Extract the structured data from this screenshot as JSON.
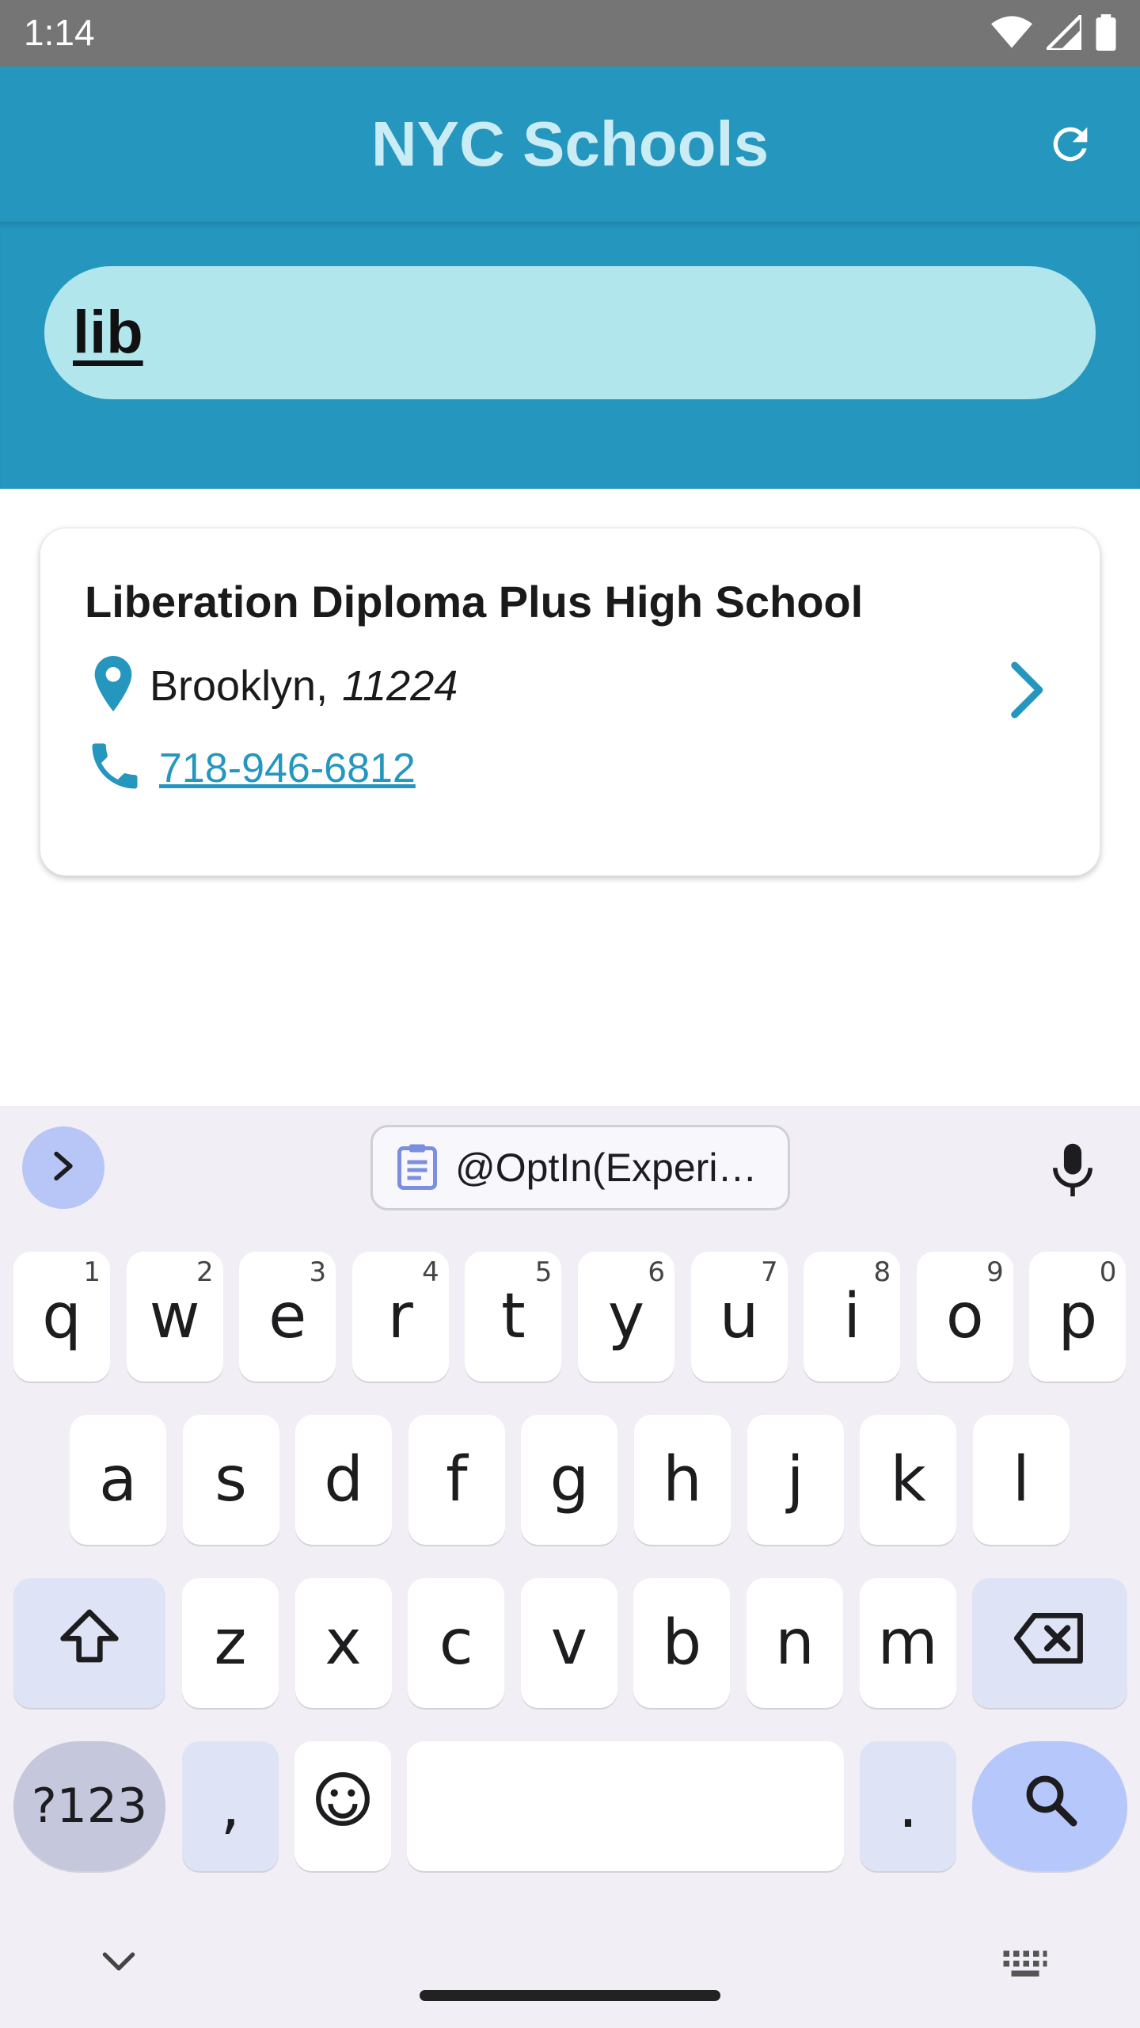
{
  "status_bar": {
    "time": "1:14"
  },
  "app_bar": {
    "title": "NYC Schools"
  },
  "search": {
    "query": "lib"
  },
  "results": [
    {
      "name": "Liberation Diploma Plus High School",
      "borough": "Brooklyn,",
      "zip": "11224",
      "phone": "718-946-6812"
    }
  ],
  "keyboard": {
    "clipboard_suggestion": "@OptIn(Experi…",
    "row1": [
      {
        "k": "q",
        "h": "1"
      },
      {
        "k": "w",
        "h": "2"
      },
      {
        "k": "e",
        "h": "3"
      },
      {
        "k": "r",
        "h": "4"
      },
      {
        "k": "t",
        "h": "5"
      },
      {
        "k": "y",
        "h": "6"
      },
      {
        "k": "u",
        "h": "7"
      },
      {
        "k": "i",
        "h": "8"
      },
      {
        "k": "o",
        "h": "9"
      },
      {
        "k": "p",
        "h": "0"
      }
    ],
    "row2": [
      "a",
      "s",
      "d",
      "f",
      "g",
      "h",
      "j",
      "k",
      "l"
    ],
    "row3": [
      "z",
      "x",
      "c",
      "v",
      "b",
      "n",
      "m"
    ],
    "symbols_label": "?123",
    "comma": ",",
    "period": "."
  },
  "colors": {
    "app_bar": "#2596be",
    "title": "#c9ecf5",
    "search_field": "#b1e6ec",
    "accent": "#2596be",
    "keyboard_bg": "#f1eff5"
  },
  "icons": [
    "wifi-icon",
    "signal-icon",
    "battery-icon",
    "refresh-icon",
    "location-pin-icon",
    "phone-icon",
    "chevron-right-icon",
    "keyboard-expand-icon",
    "clipboard-icon",
    "mic-icon",
    "shift-icon",
    "backspace-icon",
    "emoji-icon",
    "search-icon",
    "keyboard-hide-icon",
    "keyboard-switch-icon"
  ]
}
